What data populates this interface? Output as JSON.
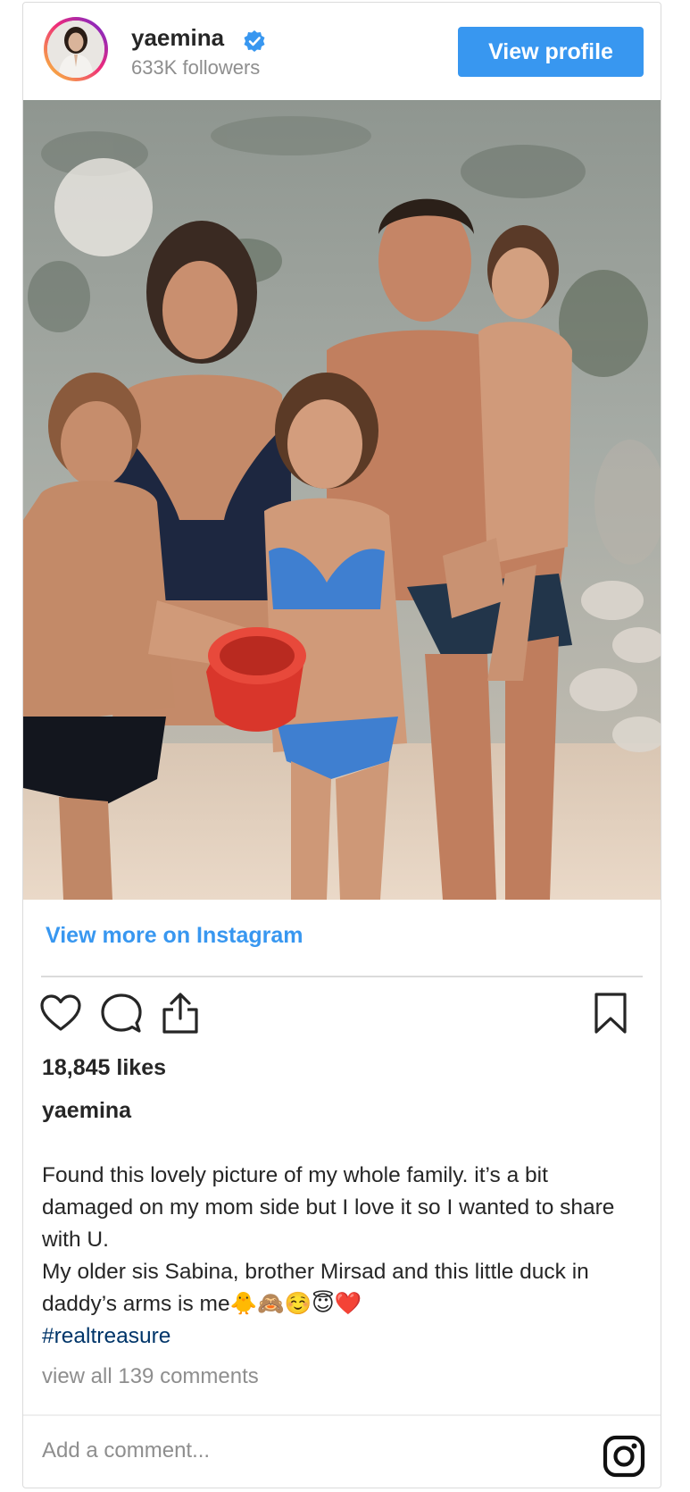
{
  "header": {
    "username": "yaemina",
    "followers": "633K followers",
    "view_profile_label": "View profile",
    "verified_icon": "verified-badge-icon"
  },
  "photo": {
    "icon": "family-beach-photo"
  },
  "links": {
    "view_more": "View more on Instagram"
  },
  "actions": {
    "icons": [
      "heart-icon",
      "comment-icon",
      "share-icon",
      "bookmark-icon"
    ]
  },
  "post": {
    "likes": "18,845 likes",
    "caption_user": "yaemina",
    "caption_lines": [
      "Found this lovely picture of my whole family. it’s a bit damaged on my mom side but I love it so I wanted to share with U.",
      "My older sis Sabina, brother Mirsad and this little duck in daddy’s arms is me🐥🙈☺️😇❤️"
    ],
    "hashtag": "#realtreasure",
    "view_comments": "view all 139 comments"
  },
  "footer": {
    "comment_placeholder": "Add a comment...",
    "instagram_icon": "instagram-icon"
  },
  "colors": {
    "accent": "#3897f0",
    "text": "#262626",
    "muted": "#8e8e8e",
    "hashtag": "#003569",
    "border": "#dbdbdb"
  }
}
